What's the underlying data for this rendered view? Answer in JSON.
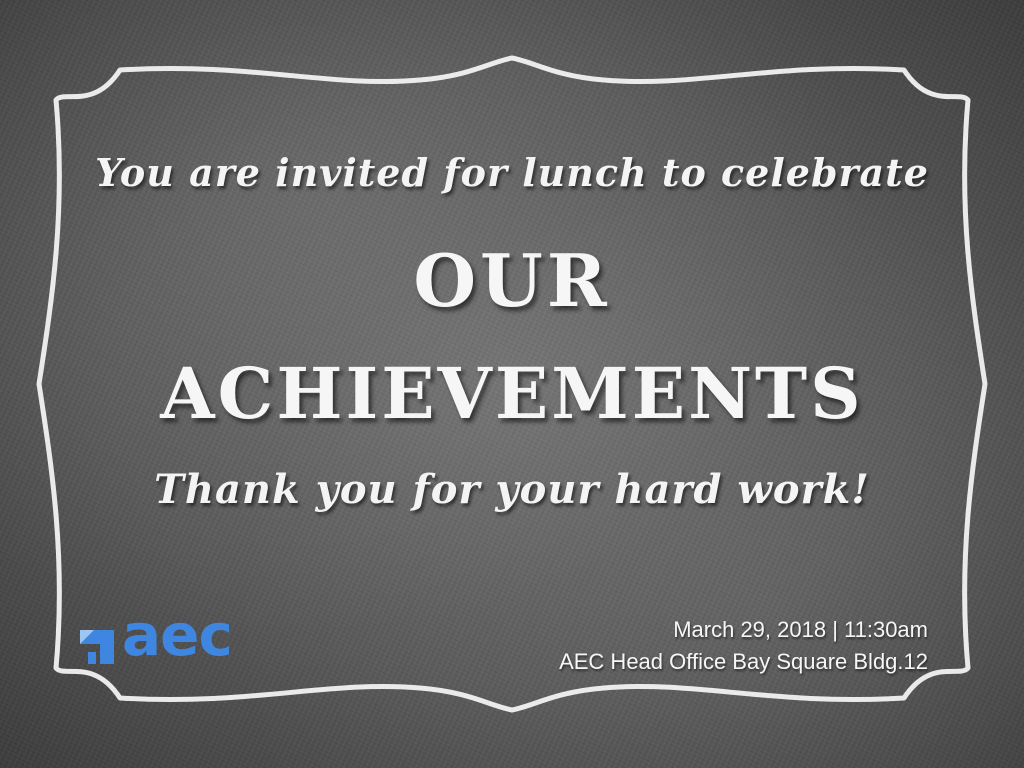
{
  "invitation": {
    "intro": "You are invited for lunch to celebrate",
    "headline_line1": "OUR",
    "headline_line2": "ACHIEVEMENTS",
    "thanks": "Thank you for your hard work!"
  },
  "logo": {
    "text": "aec",
    "color": "#3f86e0",
    "icon": "aec-arrow-logo-icon"
  },
  "event": {
    "date_time": "March 29, 2018 | 11:30am",
    "location": "AEC Head Office Bay Square Bldg.12"
  },
  "colors": {
    "chalk": "#f4f4f4",
    "board": "#555555"
  }
}
